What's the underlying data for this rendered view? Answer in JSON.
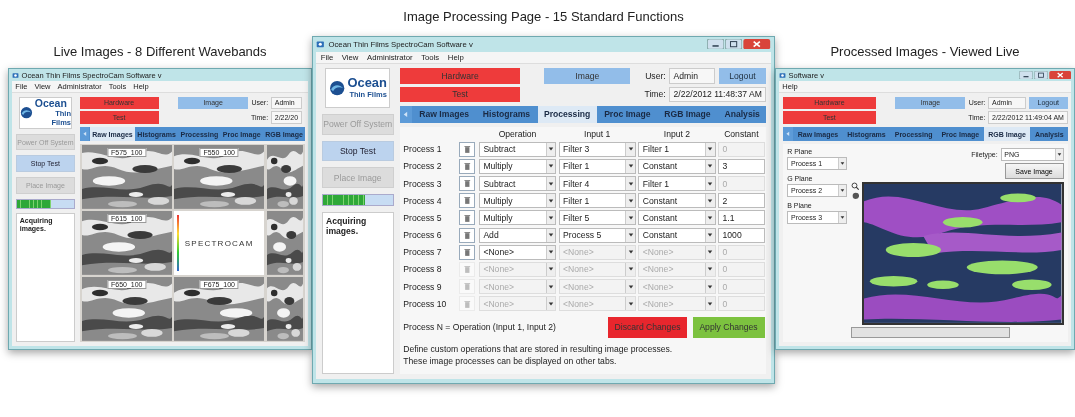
{
  "windows": [
    {
      "kind": "live",
      "caption": "Live Images - 8 Different Wavebands",
      "title": "Ocean Thin Films SpectroCam Software v",
      "menu": [
        "File",
        "View",
        "Administrator",
        "Tools",
        "Help"
      ],
      "logo": {
        "name": "Ocean",
        "tagline": "Thin Films"
      },
      "mode_buttons": [
        {
          "label": "Hardware",
          "color": "#ee3b3b"
        },
        {
          "label": "Test",
          "color": "#ee3b3b"
        },
        {
          "label": "Image",
          "color": "#92bde9"
        }
      ],
      "user_label": "User:",
      "user": "Admin",
      "time_label": "Time:",
      "time": "2/22/20",
      "controls": [
        {
          "label": "Power Off System",
          "disabled": true
        },
        {
          "label": "Stop Test",
          "disabled": false
        },
        {
          "label": "Place Image",
          "disabled": true
        }
      ],
      "progress": {
        "level": 0.6
      },
      "status": "Acquiring images.",
      "tabs": [
        {
          "label": "Raw Images",
          "selected": true
        },
        {
          "label": "Histograms",
          "selected": false
        },
        {
          "label": "Processing",
          "selected": false
        },
        {
          "label": "Proc Image",
          "selected": false
        },
        {
          "label": "RGB Image",
          "selected": false
        }
      ],
      "tiles": [
        {
          "kind": "picture",
          "label": "F575_100"
        },
        {
          "kind": "picture",
          "label": "F550_100"
        },
        {
          "kind": "picture"
        },
        {
          "kind": "picture",
          "label": "F615_100"
        },
        {
          "kind": "logo",
          "label": "SPECTROCAM"
        },
        {
          "kind": "picture"
        },
        {
          "kind": "picture",
          "label": "F650_100"
        },
        {
          "kind": "picture",
          "label": "F675_100"
        },
        {
          "kind": "picture"
        }
      ]
    },
    {
      "kind": "processing",
      "caption": "Image  Processing Page - 15 Standard Functions",
      "title": "Ocean Thin Films SpectroCam Software v",
      "menu": [
        "File",
        "View",
        "Administrator",
        "Tools",
        "Help"
      ],
      "logo": {
        "name": "Ocean",
        "tagline": "Thin Films"
      },
      "mode_buttons": [
        {
          "label": "Hardware",
          "color": "#ee3b3b"
        },
        {
          "label": "Test",
          "color": "#ee3b3b"
        },
        {
          "label": "Image",
          "color": "#92bde9"
        }
      ],
      "user_label": "User:",
      "user": "Admin",
      "logout": "Logout",
      "time_label": "Time:",
      "time": "2/22/2012 11:48:37 AM",
      "controls": [
        {
          "label": "Power Off System",
          "disabled": true
        },
        {
          "label": "Stop Test",
          "disabled": false
        },
        {
          "label": "Place Image",
          "disabled": true
        }
      ],
      "progress": {
        "level": 0.6
      },
      "status": "Acquiring images.",
      "tabs": [
        {
          "label": "Raw Images",
          "selected": false
        },
        {
          "label": "Histograms",
          "selected": false
        },
        {
          "label": "Processing",
          "selected": true
        },
        {
          "label": "Proc Image",
          "selected": false
        },
        {
          "label": "RGB Image",
          "selected": false
        },
        {
          "label": "Analysis",
          "selected": false
        }
      ],
      "columns": [
        "Operation",
        "Input 1",
        "Input 2",
        "Constant"
      ],
      "rows": [
        {
          "name": "Process 1",
          "operation": "Subtract",
          "input_1": "Filter 3",
          "input_2": "Filter 1",
          "constant": "0",
          "disabled": false,
          "inputs_disabled": false,
          "constant_disabled": true
        },
        {
          "name": "Process 2",
          "operation": "Multiply",
          "input_1": "Filter 1",
          "input_2": "Constant",
          "constant": "3",
          "disabled": false,
          "inputs_disabled": false,
          "constant_disabled": false
        },
        {
          "name": "Process 3",
          "operation": "Subtract",
          "input_1": "Filter 4",
          "input_2": "Filter 1",
          "constant": "0",
          "disabled": false,
          "inputs_disabled": false,
          "constant_disabled": true
        },
        {
          "name": "Process 4",
          "operation": "Multiply",
          "input_1": "Filter 1",
          "input_2": "Constant",
          "constant": "2",
          "disabled": false,
          "inputs_disabled": false,
          "constant_disabled": false
        },
        {
          "name": "Process 5",
          "operation": "Multiply",
          "input_1": "Filter 5",
          "input_2": "Constant",
          "constant": "1.1",
          "disabled": false,
          "inputs_disabled": false,
          "constant_disabled": false
        },
        {
          "name": "Process 6",
          "operation": "Add",
          "input_1": "Process 5",
          "input_2": "Constant",
          "constant": "1000",
          "disabled": false,
          "inputs_disabled": false,
          "constant_disabled": false
        },
        {
          "name": "Process 7",
          "operation": "<None>",
          "input_1": "<None>",
          "input_2": "<None>",
          "constant": "0",
          "disabled": false,
          "inputs_disabled": true,
          "constant_disabled": true
        },
        {
          "name": "Process 8",
          "operation": "<None>",
          "input_1": "<None>",
          "input_2": "<None>",
          "constant": "0",
          "disabled": true,
          "inputs_disabled": true,
          "constant_disabled": true
        },
        {
          "name": "Process 9",
          "operation": "<None>",
          "input_1": "<None>",
          "input_2": "<None>",
          "constant": "0",
          "disabled": true,
          "inputs_disabled": true,
          "constant_disabled": true
        },
        {
          "name": "Process 10",
          "operation": "<None>",
          "input_1": "<None>",
          "input_2": "<None>",
          "constant": "0",
          "disabled": true,
          "inputs_disabled": true,
          "constant_disabled": true
        }
      ],
      "formula": "Process N = Operation (Input 1, Input 2)",
      "discard": "Discard Changes",
      "apply": "Apply Changes",
      "description": [
        "Define custom operations that are stored in resulting image processes.",
        "These image processes can be displayed on other tabs."
      ]
    },
    {
      "kind": "rgb",
      "caption": "Processed Images - Viewed Live",
      "title": "Software v",
      "menu": [
        "Help"
      ],
      "mode_buttons": [
        {
          "label": "Hardware",
          "color": "#ee3b3b"
        },
        {
          "label": "Test",
          "color": "#ee3b3b"
        },
        {
          "label": "Image",
          "color": "#92bde9"
        }
      ],
      "user_label": "User:",
      "user": "Admin",
      "logout": "Logout",
      "time_label": "Time:",
      "time": "2/22/2012 11:49:04 AM",
      "tabs": [
        {
          "label": "Raw Images",
          "selected": false
        },
        {
          "label": "Histograms",
          "selected": false
        },
        {
          "label": "Processing",
          "selected": false
        },
        {
          "label": "Proc Image",
          "selected": false
        },
        {
          "label": "RGB Image",
          "selected": true
        },
        {
          "label": "Analysis",
          "selected": false
        }
      ],
      "planes": [
        {
          "label": "R Plane",
          "value": "Process 1"
        },
        {
          "label": "G Plane",
          "value": "Process 2"
        },
        {
          "label": "B Plane",
          "value": "Process 3"
        }
      ],
      "filetype_label": "Filetype:",
      "filetype": "PNG",
      "save": "Save Image"
    }
  ]
}
